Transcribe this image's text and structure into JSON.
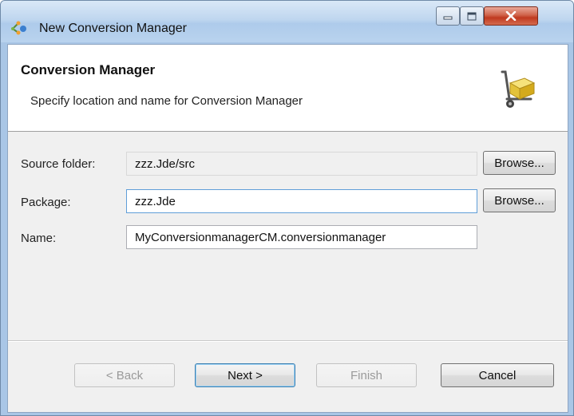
{
  "window": {
    "title": "New Conversion Manager",
    "app_icon": "eclipse-wizard-icon",
    "controls": [
      "minimize-icon",
      "maximize-icon",
      "close-icon"
    ]
  },
  "banner": {
    "title": "Conversion Manager",
    "description": "Specify location and name for Conversion Manager",
    "icon": "hand-truck-box-icon"
  },
  "form": {
    "source_folder": {
      "label": "Source folder:",
      "value": "zzz.Jde/src",
      "browse_label": "Browse..."
    },
    "package": {
      "label": "Package:",
      "value": "zzz.Jde",
      "browse_label": "Browse..."
    },
    "name": {
      "label": "Name:",
      "value": "MyConversionmanagerCM.conversionmanager"
    }
  },
  "buttons": {
    "back": "< Back",
    "next": "Next >",
    "finish": "Finish",
    "cancel": "Cancel"
  },
  "colors": {
    "titlebar": "#bfd6ef",
    "close": "#c0391f",
    "dialog_bg": "#f0f0f0",
    "focus": "#5f9ed8"
  }
}
